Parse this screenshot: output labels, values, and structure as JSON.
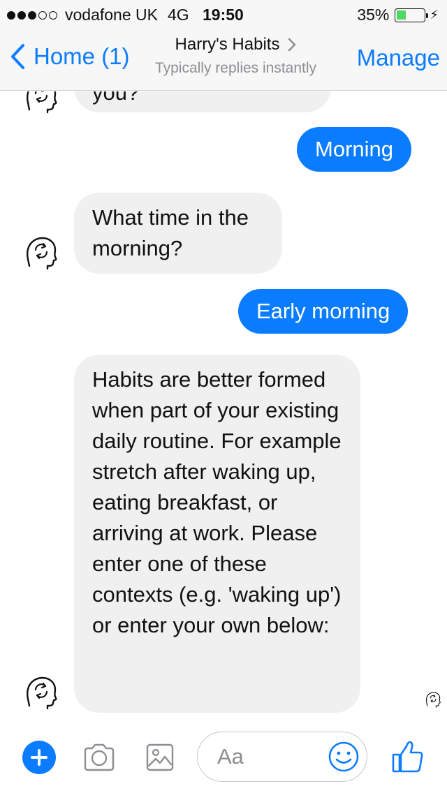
{
  "status_bar": {
    "carrier": "vodafone UK",
    "network": "4G",
    "time": "19:50",
    "battery": "35%",
    "battery_level": 0.35,
    "signal_bars_filled": 3,
    "signal_bars_total": 5
  },
  "nav": {
    "back_label": "Home (1)",
    "title": "Harry's Habits",
    "subtitle": "Typically replies instantly",
    "manage_label": "Manage"
  },
  "messages": [
    {
      "from": "bot",
      "text": "you?"
    },
    {
      "from": "user",
      "text": "Morning"
    },
    {
      "from": "bot",
      "text": "What time in the morning?"
    },
    {
      "from": "user",
      "text": "Early morning"
    },
    {
      "from": "bot",
      "text": "Habits are better formed when part of your existing daily routine. For example stretch after waking up, eating breakfast, or arriving at work. Please enter one of these contexts (e.g. 'waking up') or enter your own below:"
    }
  ],
  "compose": {
    "placeholder": "Aa",
    "icons": [
      "plus-icon",
      "camera-icon",
      "image-icon",
      "emoji-icon",
      "thumbs-up-icon"
    ]
  },
  "colors": {
    "accent": "#0a7cff",
    "incoming_bubble": "#f1f0f0",
    "battery": "#4cd964"
  }
}
